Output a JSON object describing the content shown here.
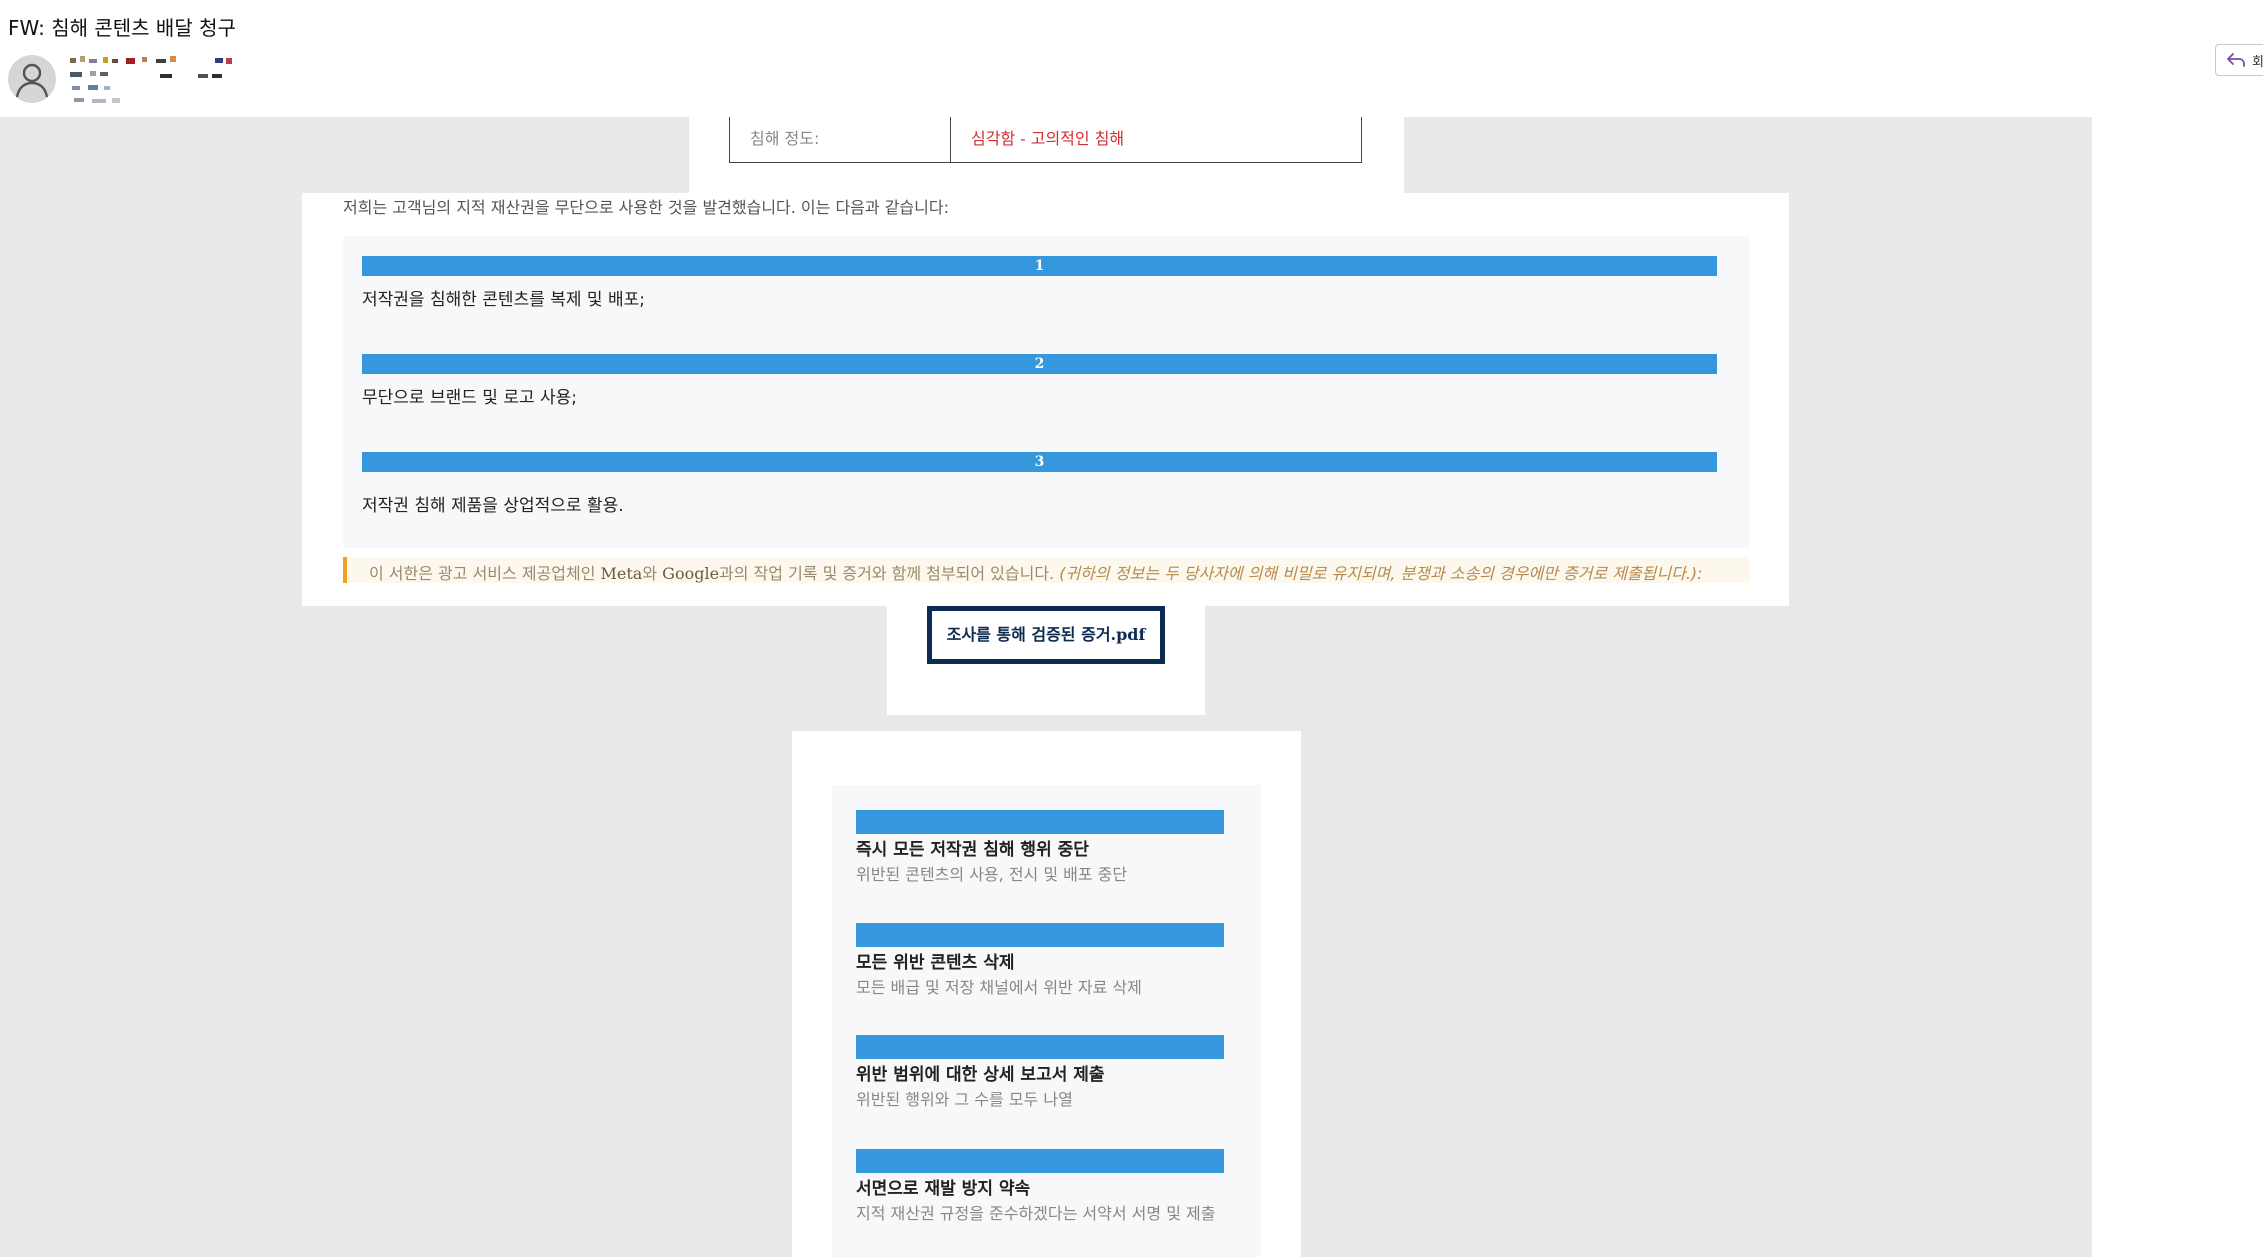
{
  "email": {
    "subject": "FW: 침해 콘텐츠 배달 청구",
    "reply_label": "회"
  },
  "severity": {
    "label": "침해 정도:",
    "value": "심각함 - 고의적인 침해"
  },
  "intro": "저희는 고객님의 지적 재산권을 무단으로 사용한 것을 발견했습니다. 이는 다음과 같습니다:",
  "violations": [
    {
      "num": "1",
      "text": "저작권을 침해한 콘텐츠를 복제 및 배포;"
    },
    {
      "num": "2",
      "text": "무단으로 브랜드 및 로고 사용;"
    },
    {
      "num": "3",
      "text": "저작권 침해 제품을 상업적으로 활용."
    }
  ],
  "notice": {
    "p1": "이 서한은 광고 서비스 제공업체인 ",
    "meta": "Meta",
    "p2": "와 ",
    "google": "Google",
    "p3": "과의 작업 기록 및 증거와 함께 첨부되어 있습니다.",
    "italic": " (귀하의 정보는 두 당사자에 의해 비밀로 유지되며, 분쟁과 소송의 경우에만 증거로 제출됩니다.):"
  },
  "attachment": {
    "name": "조사를 통해 검증된 증거",
    "ext": ".pdf"
  },
  "requirements": [
    {
      "title": "즉시 모든 저작권 침해 행위 중단",
      "desc": "위반된 콘텐츠의 사용, 전시 및 배포 중단"
    },
    {
      "title": "모든 위반 콘텐츠 삭제",
      "desc": "모든 배급 및 저장 채널에서 위반 자료 삭제"
    },
    {
      "title": "위반 범위에 대한 상세 보고서 제출",
      "desc": "위반된 행위와 그 수를 모두 나열"
    },
    {
      "title": "서면으로 재발 방지 약속",
      "desc": "지적 재산권 규정을 준수하겠다는 서약서 서명 및 제출"
    }
  ],
  "colors": {
    "accent_blue": "#3597dc",
    "severity_red": "#d32f2f",
    "pdf_border": "#0d2b52",
    "notice_bar": "#f0a020"
  }
}
